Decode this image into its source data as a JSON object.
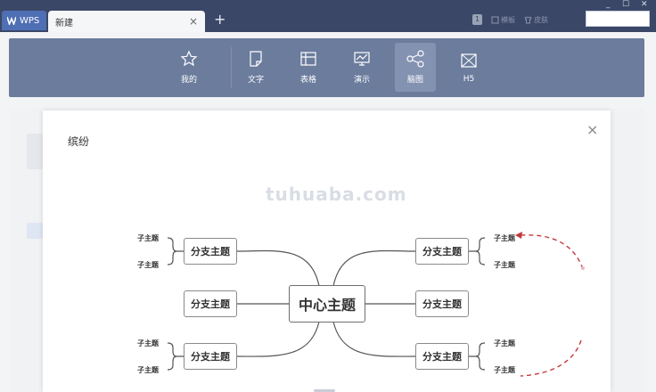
{
  "titlebar": {
    "app_tab": "WPS",
    "doc_tab": "新建",
    "close_symbol": "×",
    "new_tab_symbol": "+",
    "badge": "1",
    "templates": "模板",
    "skin": "皮肤",
    "minimize": "_",
    "maximize": "☐",
    "close": "✕"
  },
  "menu": {
    "items": [
      {
        "label": "我的",
        "icon": "star-icon"
      },
      {
        "label": "文字",
        "icon": "document-icon"
      },
      {
        "label": "表格",
        "icon": "table-icon"
      },
      {
        "label": "演示",
        "icon": "presentation-icon"
      },
      {
        "label": "脑图",
        "icon": "mindmap-icon"
      },
      {
        "label": "H5",
        "icon": "h5-icon"
      }
    ],
    "active": "脑图"
  },
  "modal": {
    "title": "缤纷",
    "close_symbol": "×",
    "watermark": "tuhuaba.com",
    "center_topic": "中心主题",
    "branch_label": "分支主题",
    "sub_label": "子主题"
  },
  "colors": {
    "titlebar": "#3b4767",
    "menubar": "#6b7c9d",
    "accent_arrow": "#c0393b"
  }
}
